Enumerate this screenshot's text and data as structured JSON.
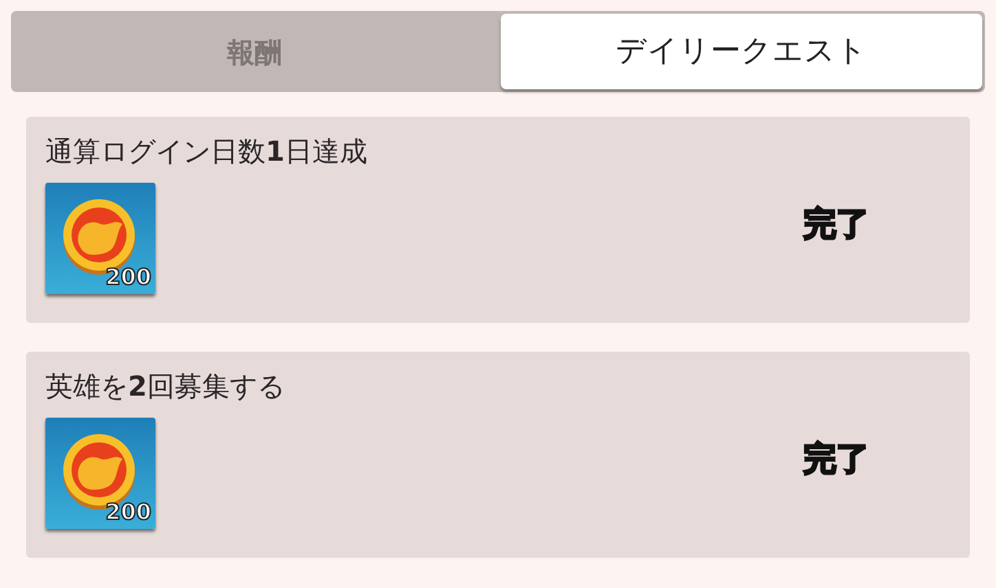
{
  "tabs": [
    {
      "label": "報酬",
      "selected": false
    },
    {
      "label": "デイリークエスト",
      "selected": true
    }
  ],
  "quests": [
    {
      "title": "通算ログイン日数**1**日達成",
      "reward_count": "200",
      "status": "完了"
    },
    {
      "title": "英雄を**2**回募集する",
      "reward_count": "200",
      "status": "完了"
    }
  ]
}
